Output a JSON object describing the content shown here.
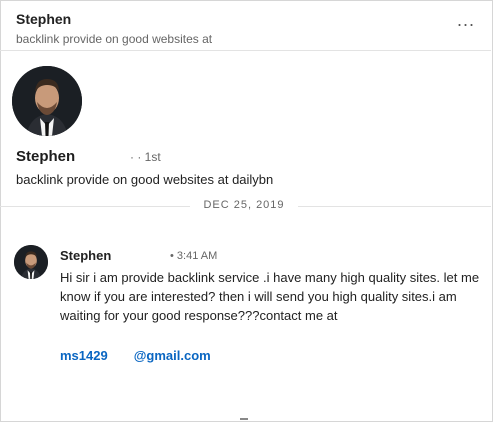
{
  "header": {
    "name": "Stephen",
    "headline": "backlink provide on good websites at",
    "more_icon": "ellipsis-icon",
    "more_label": "..."
  },
  "profile": {
    "name": "Stephen",
    "degree": "· · 1st",
    "headline": "backlink provide on good websites at dailybn"
  },
  "date_separator": "DEC 25, 2019",
  "message": {
    "sender": "Stephen",
    "time": "• 3:41 AM",
    "body": "Hi sir i am provide backlink service .i have many high quality sites. let me know if you are interested? then i will send you high quality sites.i am waiting for your good response???contact me at",
    "email_part1": "ms1429",
    "email_part2": "@gmail.com"
  },
  "colors": {
    "link": "#0a66c2",
    "divider": "#e3e3e3"
  }
}
